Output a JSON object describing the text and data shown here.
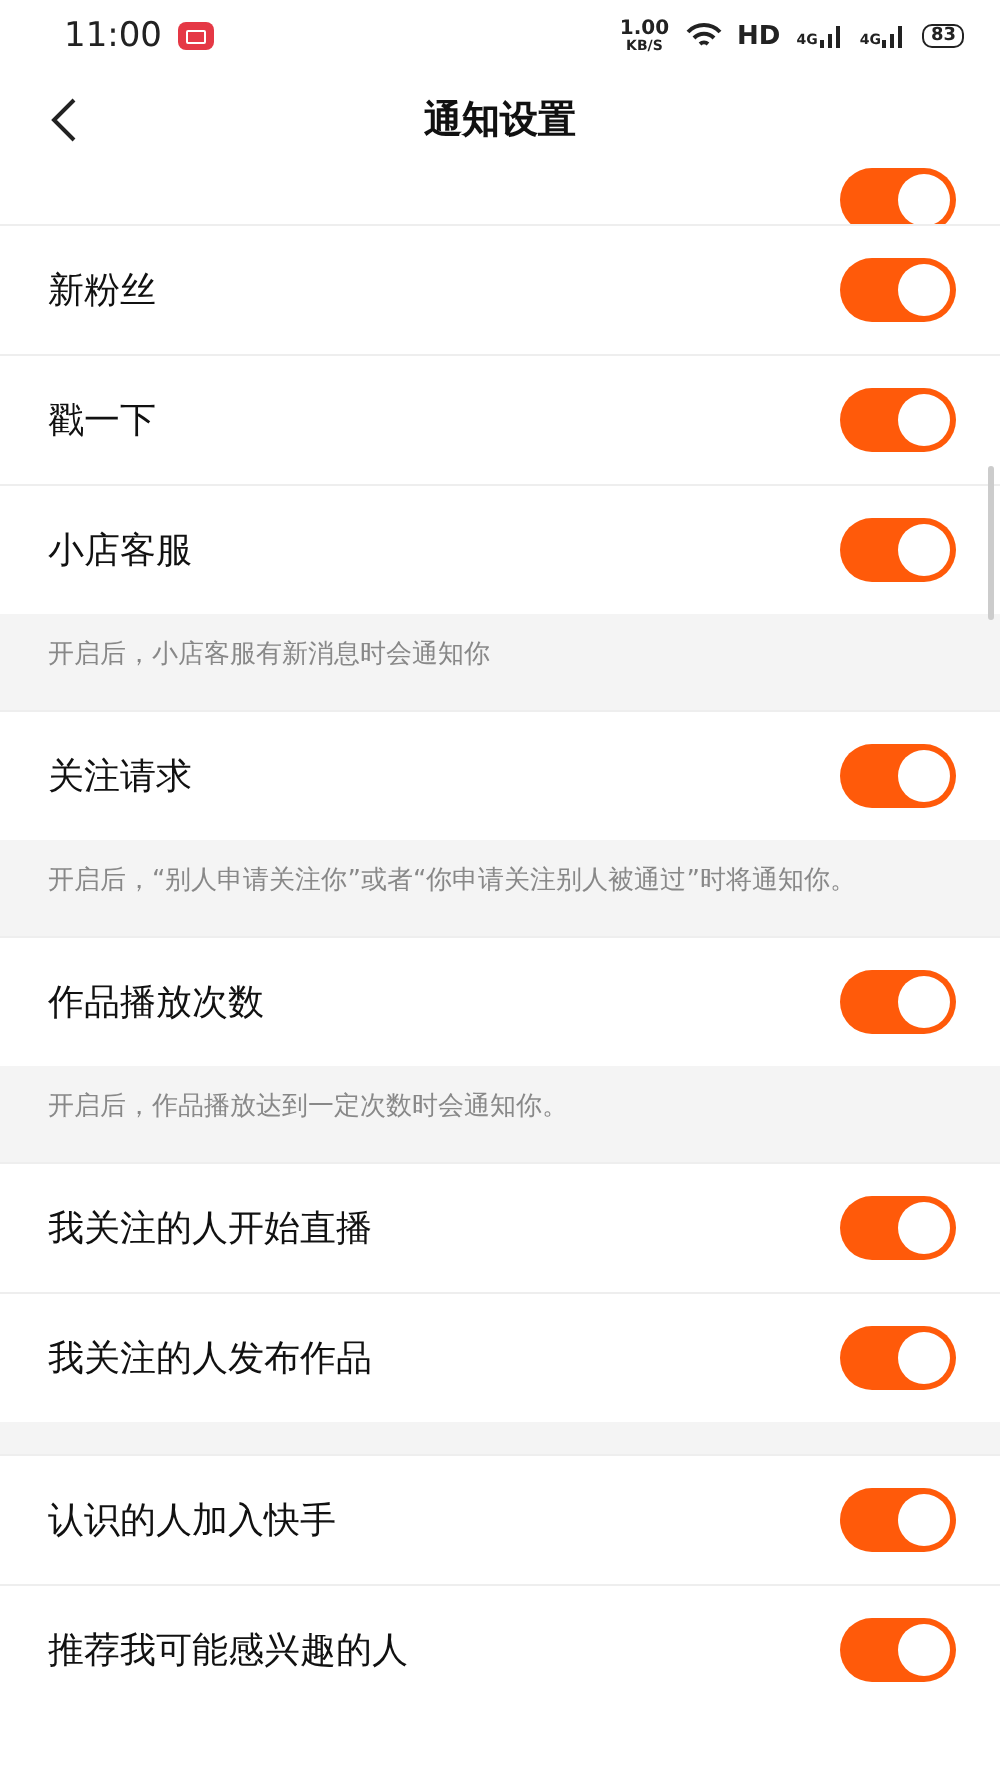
{
  "status_bar": {
    "time": "11:00",
    "speed_value": "1.00",
    "speed_unit": "KB/S",
    "hd": "HD",
    "network_1": "4G",
    "network_2": "4G",
    "battery": "83"
  },
  "header": {
    "title": "通知设置"
  },
  "items": [
    {
      "kind": "clipped",
      "on": true
    },
    {
      "kind": "toggle",
      "label": "新粉丝",
      "on": true
    },
    {
      "kind": "toggle",
      "label": "戳一下",
      "on": true
    },
    {
      "kind": "toggle",
      "label": "小店客服",
      "on": true
    },
    {
      "kind": "note",
      "text": "开启后，小店客服有新消息时会通知你"
    },
    {
      "kind": "toggle",
      "label": "关注请求",
      "on": true
    },
    {
      "kind": "note",
      "text": "开启后，“别人申请关注你”或者“你申请关注别人被通过”时将通知你。"
    },
    {
      "kind": "toggle",
      "label": "作品播放次数",
      "on": true
    },
    {
      "kind": "note",
      "text": "开启后，作品播放达到一定次数时会通知你。"
    },
    {
      "kind": "toggle",
      "label": "我关注的人开始直播",
      "on": true
    },
    {
      "kind": "toggle",
      "label": "我关注的人发布作品",
      "on": true
    },
    {
      "kind": "gap"
    },
    {
      "kind": "toggle",
      "label": "认识的人加入快手",
      "on": true
    },
    {
      "kind": "toggle",
      "label": "推荐我可能感兴趣的人",
      "on": true
    }
  ]
}
